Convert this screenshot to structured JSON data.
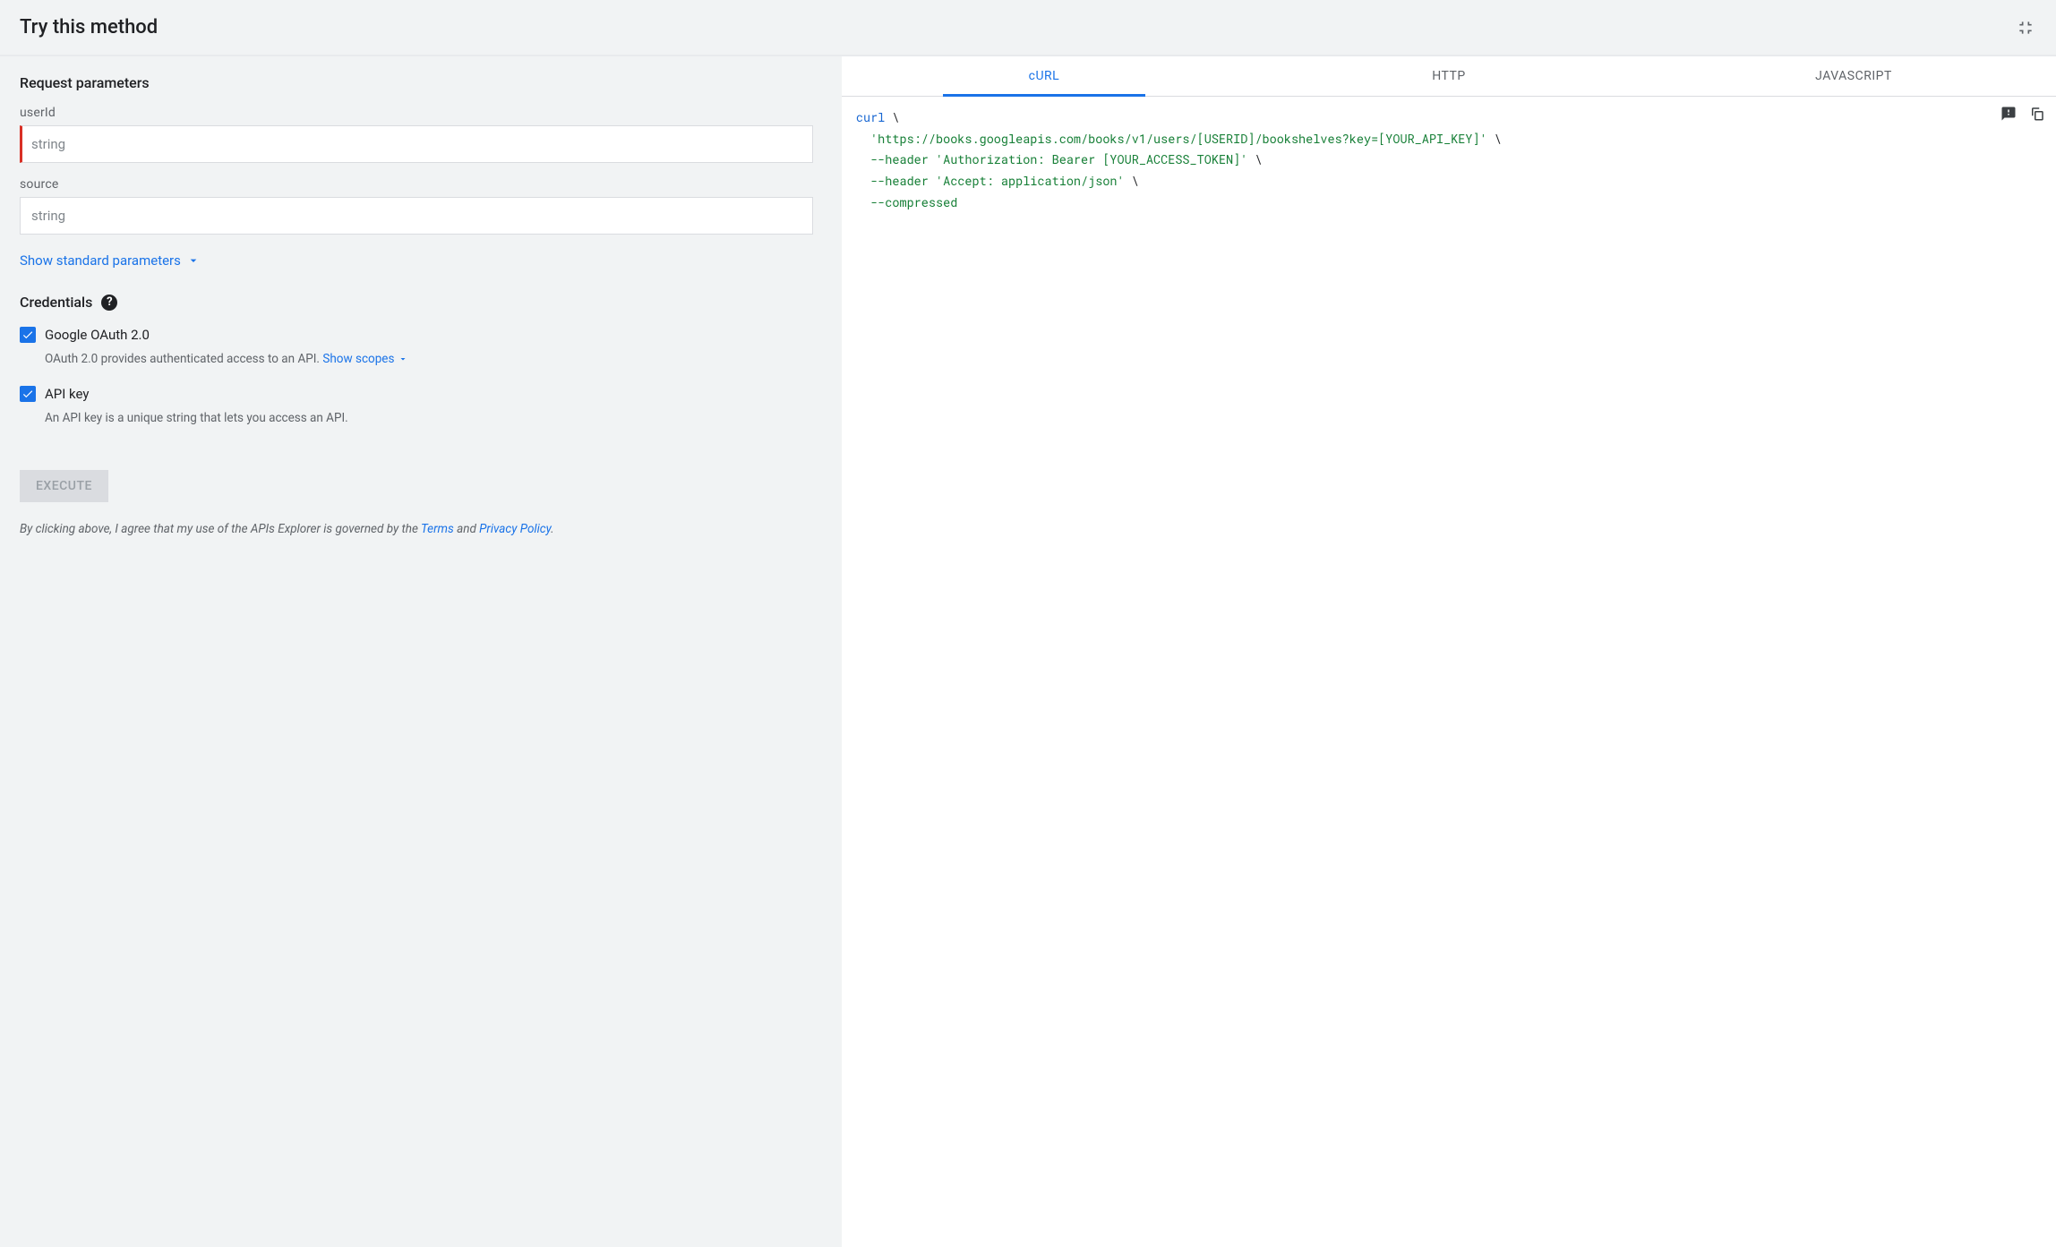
{
  "header": {
    "title": "Try this method"
  },
  "params_section": {
    "title": "Request parameters",
    "userId": {
      "label": "userId",
      "placeholder": "string"
    },
    "source": {
      "label": "source",
      "placeholder": "string"
    },
    "show_standard": "Show standard parameters"
  },
  "credentials": {
    "title": "Credentials",
    "oauth": {
      "label": "Google OAuth 2.0",
      "desc": "OAuth 2.0 provides authenticated access to an API. ",
      "show_scopes": "Show scopes"
    },
    "apikey": {
      "label": "API key",
      "desc": "An API key is a unique string that lets you access an API."
    }
  },
  "execute_label": "EXECUTE",
  "disclaimer": {
    "pre": "By clicking above, I agree that my use of the APIs Explorer is governed by the ",
    "terms": "Terms",
    "mid": " and ",
    "privacy": "Privacy Policy",
    "post": "."
  },
  "tabs": {
    "curl": "cURL",
    "http": "HTTP",
    "js": "JAVASCRIPT"
  },
  "code": {
    "curl_kw": "curl",
    "bs": " \\",
    "url": "'https://books.googleapis.com/books/v1/users/[USERID]/bookshelves?key=[YOUR_API_KEY]'",
    "hdr1": "--header",
    "auth": " 'Authorization: Bearer [YOUR_ACCESS_TOKEN]'",
    "accept": " 'Accept: application/json'",
    "compressed": "--compressed"
  }
}
